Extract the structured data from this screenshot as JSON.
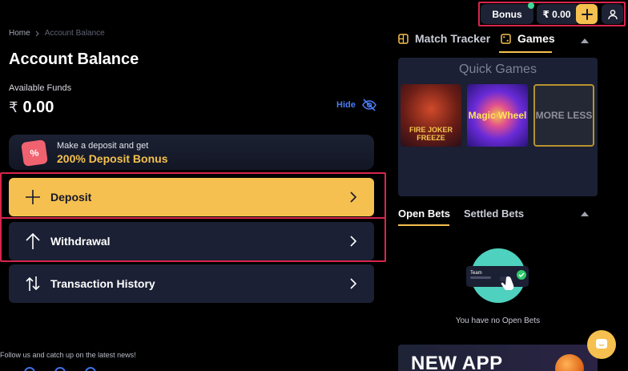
{
  "header": {
    "bonus_label": "Bonus",
    "balance": "₹ 0.00",
    "icons": [
      "plus-icon",
      "user-icon"
    ]
  },
  "breadcrumb": {
    "home": "Home",
    "current": "Account Balance"
  },
  "page": {
    "title": "Account Balance",
    "funds_label": "Available Funds",
    "currency_symbol": "₹",
    "amount": "0.00",
    "hide_label": "Hide"
  },
  "promo": {
    "line1": "Make a deposit and get",
    "line2": "200% Deposit Bonus"
  },
  "actions": {
    "deposit": "Deposit",
    "withdrawal": "Withdrawal",
    "history": "Transaction History"
  },
  "footer": {
    "follow_text": "Follow us and catch up on the latest news!"
  },
  "right": {
    "tabs": [
      "Match Tracker",
      "Games"
    ],
    "active_tab": "Games",
    "quick_games_title": "Quick Games",
    "games": [
      {
        "title": "FIRE JOKER FREEZE"
      },
      {
        "title": "Magic Wheel"
      },
      {
        "title": "MORE LESS"
      }
    ],
    "bets_tabs": [
      "Open Bets",
      "Settled Bets"
    ],
    "active_bets_tab": "Open Bets",
    "illustration_label": "Team",
    "no_bets_text": "You have no Open Bets",
    "banner_text": "NEW APP"
  },
  "colors": {
    "accent": "#f5c04f",
    "panel": "#1b2034",
    "highlight": "#d8254c",
    "link": "#4a7cf5",
    "online": "#3ddc97"
  }
}
